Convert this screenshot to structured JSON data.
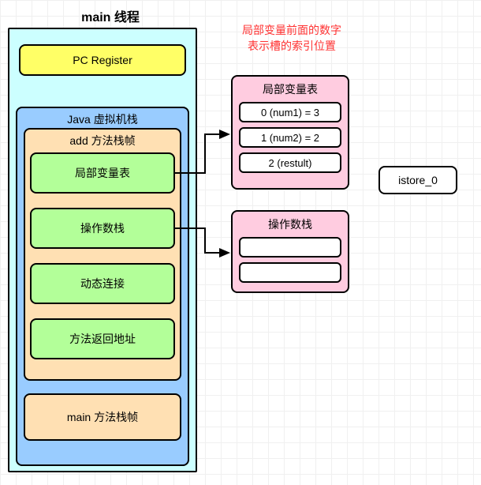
{
  "colors": {
    "cyan": "#CCFFFF",
    "yellow": "#FFFF66",
    "blue": "#99CCFF",
    "orange": "#FFE0B3",
    "green": "#B3FF99",
    "pink": "#FFCCE0",
    "red_text": "#FF3333"
  },
  "thread_title": "main 线程",
  "pc_register": "PC Register",
  "jvm_stack_title": "Java 虚拟机栈",
  "add_frame_title": "add 方法栈帧",
  "frame_sections": {
    "local_var_table": "局部变量表",
    "operand_stack": "操作数栈",
    "dynamic_linking": "动态连接",
    "return_address": "方法返回地址"
  },
  "main_frame": "main 方法栈帧",
  "note": {
    "line1": "局部变量前面的数字",
    "line2": "表示槽的索引位置"
  },
  "local_var_panel": {
    "title": "局部变量表",
    "rows": [
      "0 (num1) = 3",
      "1 (num2) = 2",
      "2 (restult)"
    ]
  },
  "operand_panel": {
    "title": "操作数栈",
    "rows": [
      "",
      ""
    ]
  },
  "instruction": "istore_0"
}
